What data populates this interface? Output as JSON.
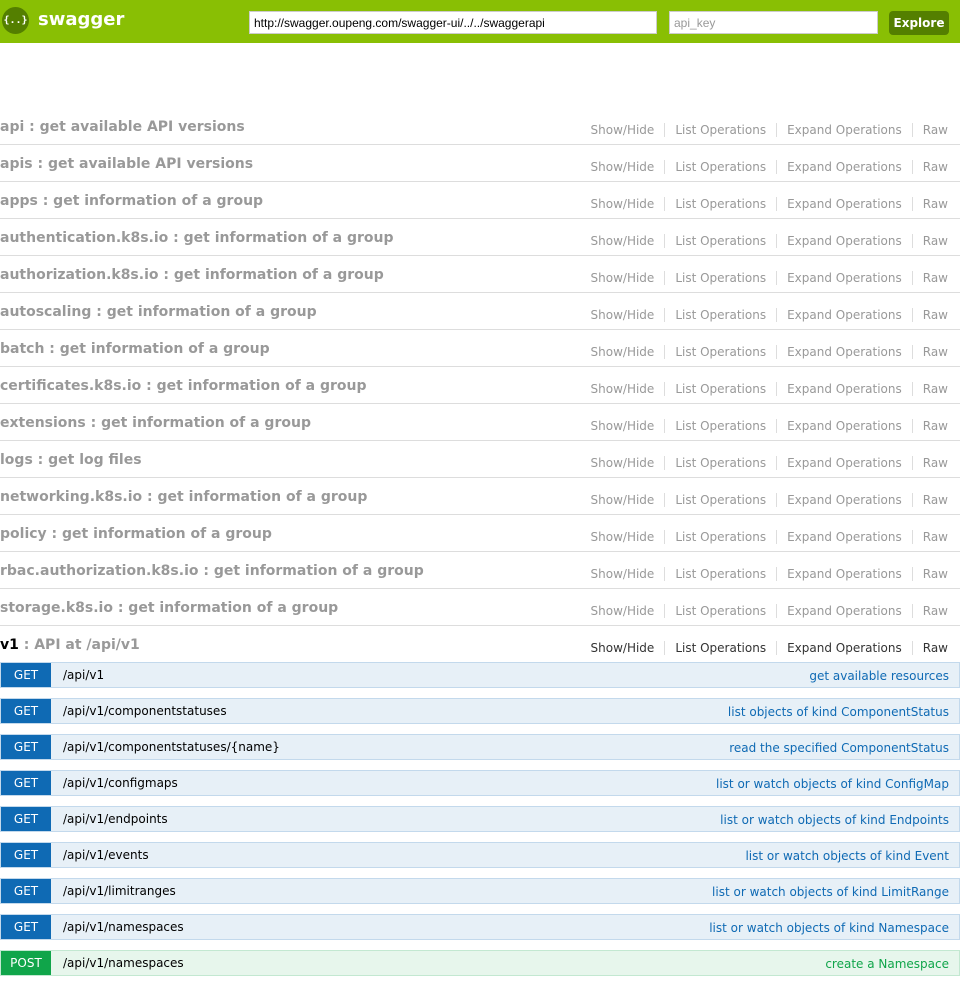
{
  "header": {
    "logo_glyph": "{..}",
    "brand": "swagger",
    "url_value": "http://swagger.oupeng.com/swagger-ui/../../swaggerapi",
    "api_key_placeholder": "api_key",
    "explore_label": "Explore",
    "bar_color": "#89bf04"
  },
  "operation_links": {
    "show_hide": "Show/Hide",
    "list_operations": "List Operations",
    "expand_operations": "Expand Operations",
    "raw": "Raw"
  },
  "resources": [
    {
      "name": "api",
      "desc": " : get available API versions"
    },
    {
      "name": "apis",
      "desc": " : get available API versions"
    },
    {
      "name": "apps",
      "desc": " : get information of a group"
    },
    {
      "name": "authentication.k8s.io",
      "desc": " : get information of a group"
    },
    {
      "name": "authorization.k8s.io",
      "desc": " : get information of a group"
    },
    {
      "name": "autoscaling",
      "desc": " : get information of a group"
    },
    {
      "name": "batch",
      "desc": " : get information of a group"
    },
    {
      "name": "certificates.k8s.io",
      "desc": " : get information of a group"
    },
    {
      "name": "extensions",
      "desc": " : get information of a group"
    },
    {
      "name": "logs",
      "desc": " : get log files"
    },
    {
      "name": "networking.k8s.io",
      "desc": " : get information of a group"
    },
    {
      "name": "policy",
      "desc": " : get information of a group"
    },
    {
      "name": "rbac.authorization.k8s.io",
      "desc": " : get information of a group"
    },
    {
      "name": "storage.k8s.io",
      "desc": " : get information of a group"
    },
    {
      "name": "v1",
      "desc": " : API at /api/v1"
    }
  ],
  "endpoints": [
    {
      "method": "GET",
      "path": "/api/v1",
      "summary": "get available resources"
    },
    {
      "method": "GET",
      "path": "/api/v1/componentstatuses",
      "summary": "list objects of kind ComponentStatus"
    },
    {
      "method": "GET",
      "path": "/api/v1/componentstatuses/{name}",
      "summary": "read the specified ComponentStatus"
    },
    {
      "method": "GET",
      "path": "/api/v1/configmaps",
      "summary": "list or watch objects of kind ConfigMap"
    },
    {
      "method": "GET",
      "path": "/api/v1/endpoints",
      "summary": "list or watch objects of kind Endpoints"
    },
    {
      "method": "GET",
      "path": "/api/v1/events",
      "summary": "list or watch objects of kind Event"
    },
    {
      "method": "GET",
      "path": "/api/v1/limitranges",
      "summary": "list or watch objects of kind LimitRange"
    },
    {
      "method": "GET",
      "path": "/api/v1/namespaces",
      "summary": "list or watch objects of kind Namespace"
    },
    {
      "method": "POST",
      "path": "/api/v1/namespaces",
      "summary": "create a Namespace"
    }
  ]
}
